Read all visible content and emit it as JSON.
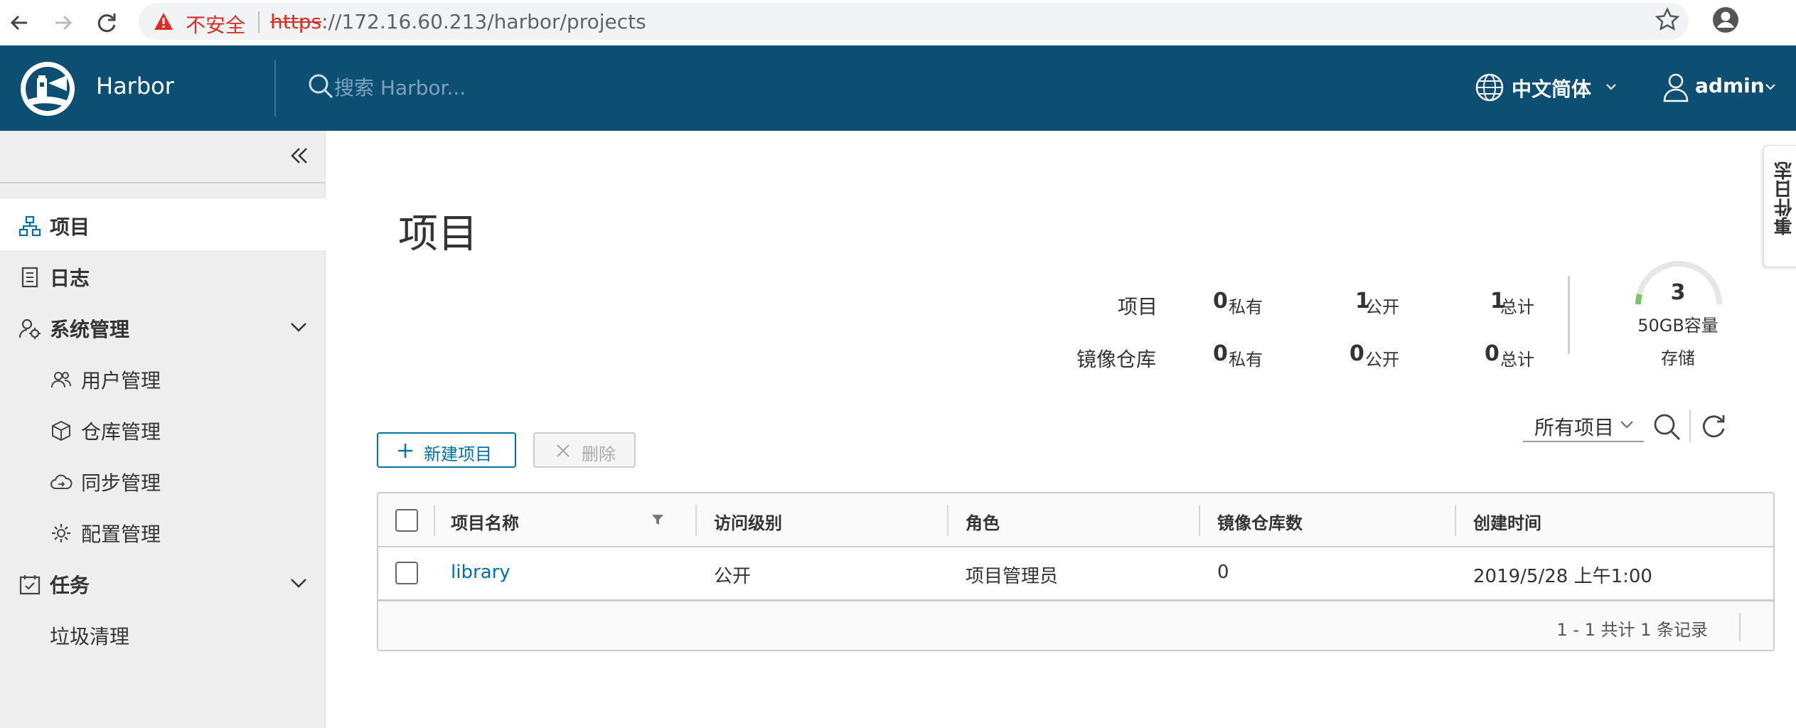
{
  "browser": {
    "security_label": "不安全",
    "url_scheme": "https",
    "url_rest": "://172.16.60.213/harbor/projects"
  },
  "header": {
    "brand": "Harbor",
    "search_placeholder": "搜索 Harbor...",
    "language": "中文简体",
    "user": "admin",
    "bg_color": "#0d4e73"
  },
  "sidebar": {
    "items": [
      {
        "label": "项目",
        "icon": "projects-icon",
        "active": true
      },
      {
        "label": "日志",
        "icon": "logs-icon"
      },
      {
        "label": "系统管理",
        "icon": "admin-icon",
        "expanded": true
      },
      {
        "label": "用户管理",
        "icon": "users-icon"
      },
      {
        "label": "仓库管理",
        "icon": "registry-icon"
      },
      {
        "label": "同步管理",
        "icon": "replication-icon"
      },
      {
        "label": "配置管理",
        "icon": "config-icon"
      },
      {
        "label": "任务",
        "icon": "tasks-icon",
        "expanded": true
      },
      {
        "label": "垃圾清理"
      }
    ]
  },
  "main": {
    "title": "项目",
    "stats": {
      "projects_label": "项目",
      "repos_label": "镜像仓库",
      "private_suffix": "私有",
      "public_suffix": "公开",
      "total_suffix": "总计",
      "projects": {
        "private": "0",
        "public": "1",
        "total": "1"
      },
      "repos": {
        "private": "0",
        "public": "0",
        "total": "0"
      }
    },
    "storage": {
      "count": "3",
      "capacity": "50GB容量",
      "label": "存储"
    },
    "event_log_tab": "事件日志",
    "toolbar": {
      "new_project": "新建项目",
      "delete": "删除",
      "filter_value": "所有项目"
    },
    "table": {
      "columns": [
        "项目名称",
        "访问级别",
        "角色",
        "镜像仓库数",
        "创建时间"
      ],
      "rows": [
        {
          "name": "library",
          "access": "公开",
          "role": "项目管理员",
          "repo_count": "0",
          "created": "2019/5/28 上午1:00"
        }
      ],
      "footer": "1 - 1 共计 1 条记录"
    }
  }
}
